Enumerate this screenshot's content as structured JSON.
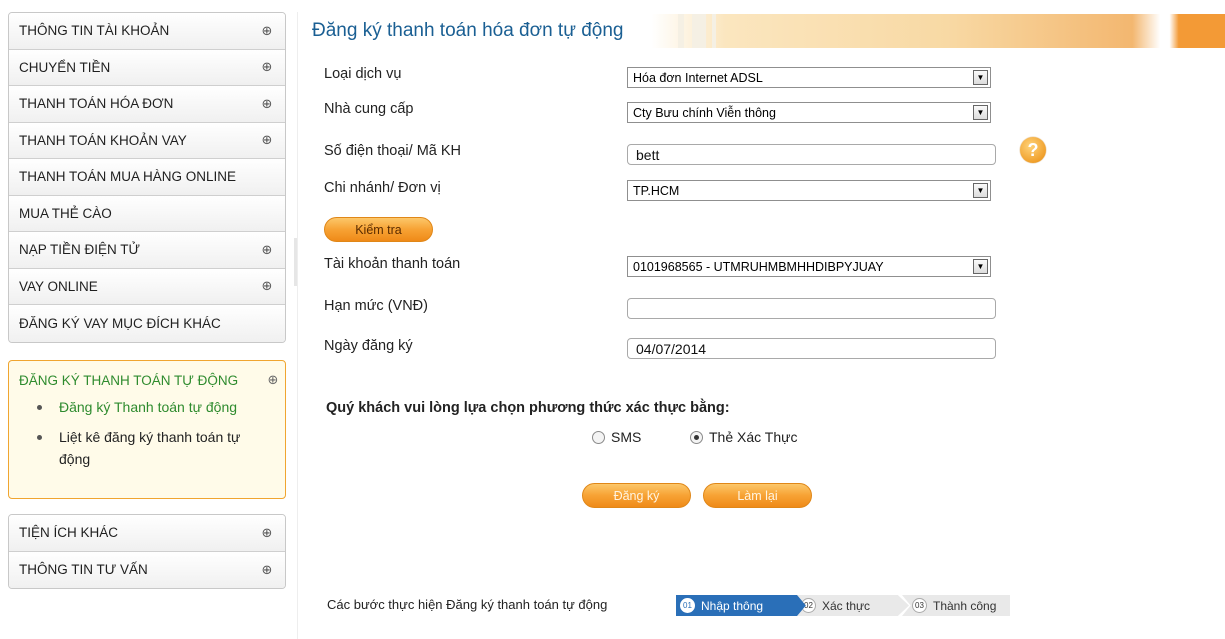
{
  "sidebar": {
    "group1": [
      {
        "label": "THÔNG TIN TÀI KHOẢN",
        "expandable": true
      },
      {
        "label": "CHUYỂN TIỀN",
        "expandable": true
      },
      {
        "label": "THANH TOÁN HÓA ĐƠN",
        "expandable": true
      },
      {
        "label": "THANH TOÁN KHOẢN VAY",
        "expandable": true
      },
      {
        "label": "THANH TOÁN MUA HÀNG ONLINE",
        "expandable": false
      },
      {
        "label": "MUA THẺ CÀO",
        "expandable": false
      },
      {
        "label": "NẠP TIỀN ĐIỆN TỬ",
        "expandable": true
      },
      {
        "label": "VAY ONLINE",
        "expandable": true
      },
      {
        "label": "ĐĂNG KÝ VAY MỤC ĐÍCH KHÁC",
        "expandable": false
      }
    ],
    "active": {
      "label": "ĐĂNG KÝ THANH TOÁN TỰ ĐỘNG",
      "sub1": "Đăng ký Thanh toán tự động",
      "sub2": "Liệt kê đăng ký thanh toán tự động"
    },
    "group2": [
      {
        "label": "TIỆN ÍCH KHÁC",
        "expandable": true
      },
      {
        "label": "THÔNG TIN TƯ VẤN",
        "expandable": true
      }
    ],
    "plus_glyph": "⊕"
  },
  "page": {
    "title": "Đăng ký thanh toán hóa đơn tự động"
  },
  "form": {
    "service_type": {
      "label": "Loại dịch vụ",
      "value": "Hóa đơn Internet ADSL"
    },
    "provider": {
      "label": "Nhà cung cấp",
      "value": "Cty Bưu chính Viễn thông"
    },
    "phone": {
      "label": "Số điện thoại/ Mã KH",
      "value": "bett"
    },
    "branch": {
      "label": "Chi nhánh/ Đơn vị",
      "value": "TP.HCM"
    },
    "check_button": "Kiểm tra",
    "account": {
      "label": "Tài khoản thanh toán",
      "value": "0101968565 - UTMRUHMBMHHDIBPYJUAY"
    },
    "limit": {
      "label": "Hạn mức (VNĐ)",
      "value": ""
    },
    "reg_date": {
      "label": "Ngày đăng ký",
      "value": "04/07/2014"
    },
    "help_glyph": "?",
    "select_arrow": "▼"
  },
  "auth": {
    "prompt": "Quý khách vui lòng lựa chọn phương thức xác thực bằng:",
    "options": [
      {
        "label": "SMS",
        "checked": false
      },
      {
        "label": "Thẻ Xác Thực",
        "checked": true
      }
    ]
  },
  "actions": {
    "register": "Đăng ký",
    "reset": "Làm lại"
  },
  "steps": {
    "label": "Các bước thực hiện Đăng ký thanh toán tự động",
    "items": [
      {
        "num": "01",
        "label": "Nhập thông",
        "active": true
      },
      {
        "num": "02",
        "label": "Xác thực",
        "active": false
      },
      {
        "num": "03",
        "label": "Thành công",
        "active": false
      }
    ]
  },
  "colors": {
    "accent_orange": "#f7a234",
    "title_blue": "#1a5f93",
    "active_green": "#2e8b2e",
    "step_blue": "#2a6fb8"
  }
}
